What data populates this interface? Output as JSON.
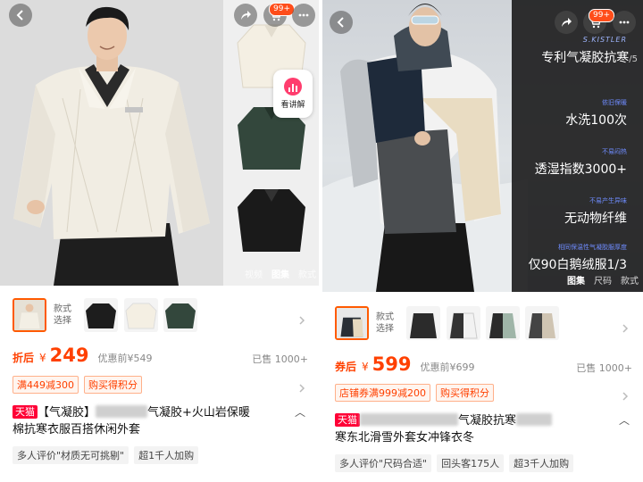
{
  "left": {
    "badge": "99+",
    "kanjiang": "看讲解",
    "media_tabs": [
      "视频",
      "图集",
      "款式"
    ],
    "style_label": "款式\n选择",
    "price_tag": "折后",
    "yen": "¥",
    "price": "249",
    "orig_price": "优惠前¥549",
    "sold": "已售 1000+",
    "promos": [
      "满449减300",
      "购买得积分"
    ],
    "tmall": "天猫",
    "title_a": "【气凝胶】",
    "title_b": "气凝胶+火山岩保暖",
    "title_c": "棉抗寒衣服百搭休闲外套",
    "reviews": [
      "多人评价\"材质无可挑剔\"",
      "超1千人加购"
    ]
  },
  "right": {
    "badge": "99+",
    "brand": "S.KISTLER",
    "feat_title": "专利气凝胶抗寒",
    "page_counter": "/5",
    "features": [
      {
        "sub": "依旧保暖",
        "main": "水洗100次"
      },
      {
        "sub": "不易闷热",
        "main": "透湿指数3000+"
      },
      {
        "sub": "不易产生异味",
        "main": "无动物纤维"
      },
      {
        "sub": "相同保温性气凝胶服厚度",
        "main": "仅90白鹅绒服1/3"
      }
    ],
    "media_tabs": [
      "图集",
      "尺码",
      "款式"
    ],
    "style_label": "款式\n选择",
    "price_tag": "券后",
    "yen": "¥",
    "price": "599",
    "orig_price": "优惠前¥699",
    "sold": "已售 1000+",
    "promos": [
      "店铺券满999减200",
      "购买得积分"
    ],
    "tmall": "天猫",
    "title_a": "气凝胶抗寒",
    "title_b": "寒东北滑雪外套女冲锋衣冬",
    "reviews": [
      "多人评价\"尺码合适\"",
      "回头客175人",
      "超3千人加购"
    ]
  },
  "colors": {
    "accent": "#ff4000",
    "tmall": "#ff0036",
    "feature_blue": "#6f8cff"
  }
}
